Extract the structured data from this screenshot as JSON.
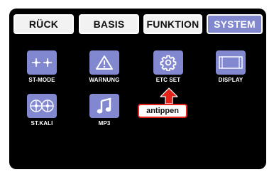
{
  "tabs": [
    {
      "label": "RÜCK"
    },
    {
      "label": "BASIS"
    },
    {
      "label": "FUNKTION"
    },
    {
      "label": "SYSTEM",
      "active": true
    }
  ],
  "grid": {
    "items": [
      {
        "label": "ST-MODE",
        "icon": "stick-mode-icon"
      },
      {
        "label": "WARNUNG",
        "icon": "warning-icon"
      },
      {
        "label": "ETC SET",
        "icon": "gear-icon"
      },
      {
        "label": "DISPLAY",
        "icon": "display-icon"
      },
      {
        "label": "ST.KALI",
        "icon": "stick-calibration-icon"
      },
      {
        "label": "MP3",
        "icon": "music-note-icon"
      }
    ]
  },
  "annotation": {
    "text": "antippen",
    "arrow_icon": "arrow-up-icon"
  },
  "colors": {
    "screen_bg": "#000000",
    "accent": "#8288cf",
    "tab_bg": "#f2f2f2",
    "callout_border": "#e2231a"
  }
}
